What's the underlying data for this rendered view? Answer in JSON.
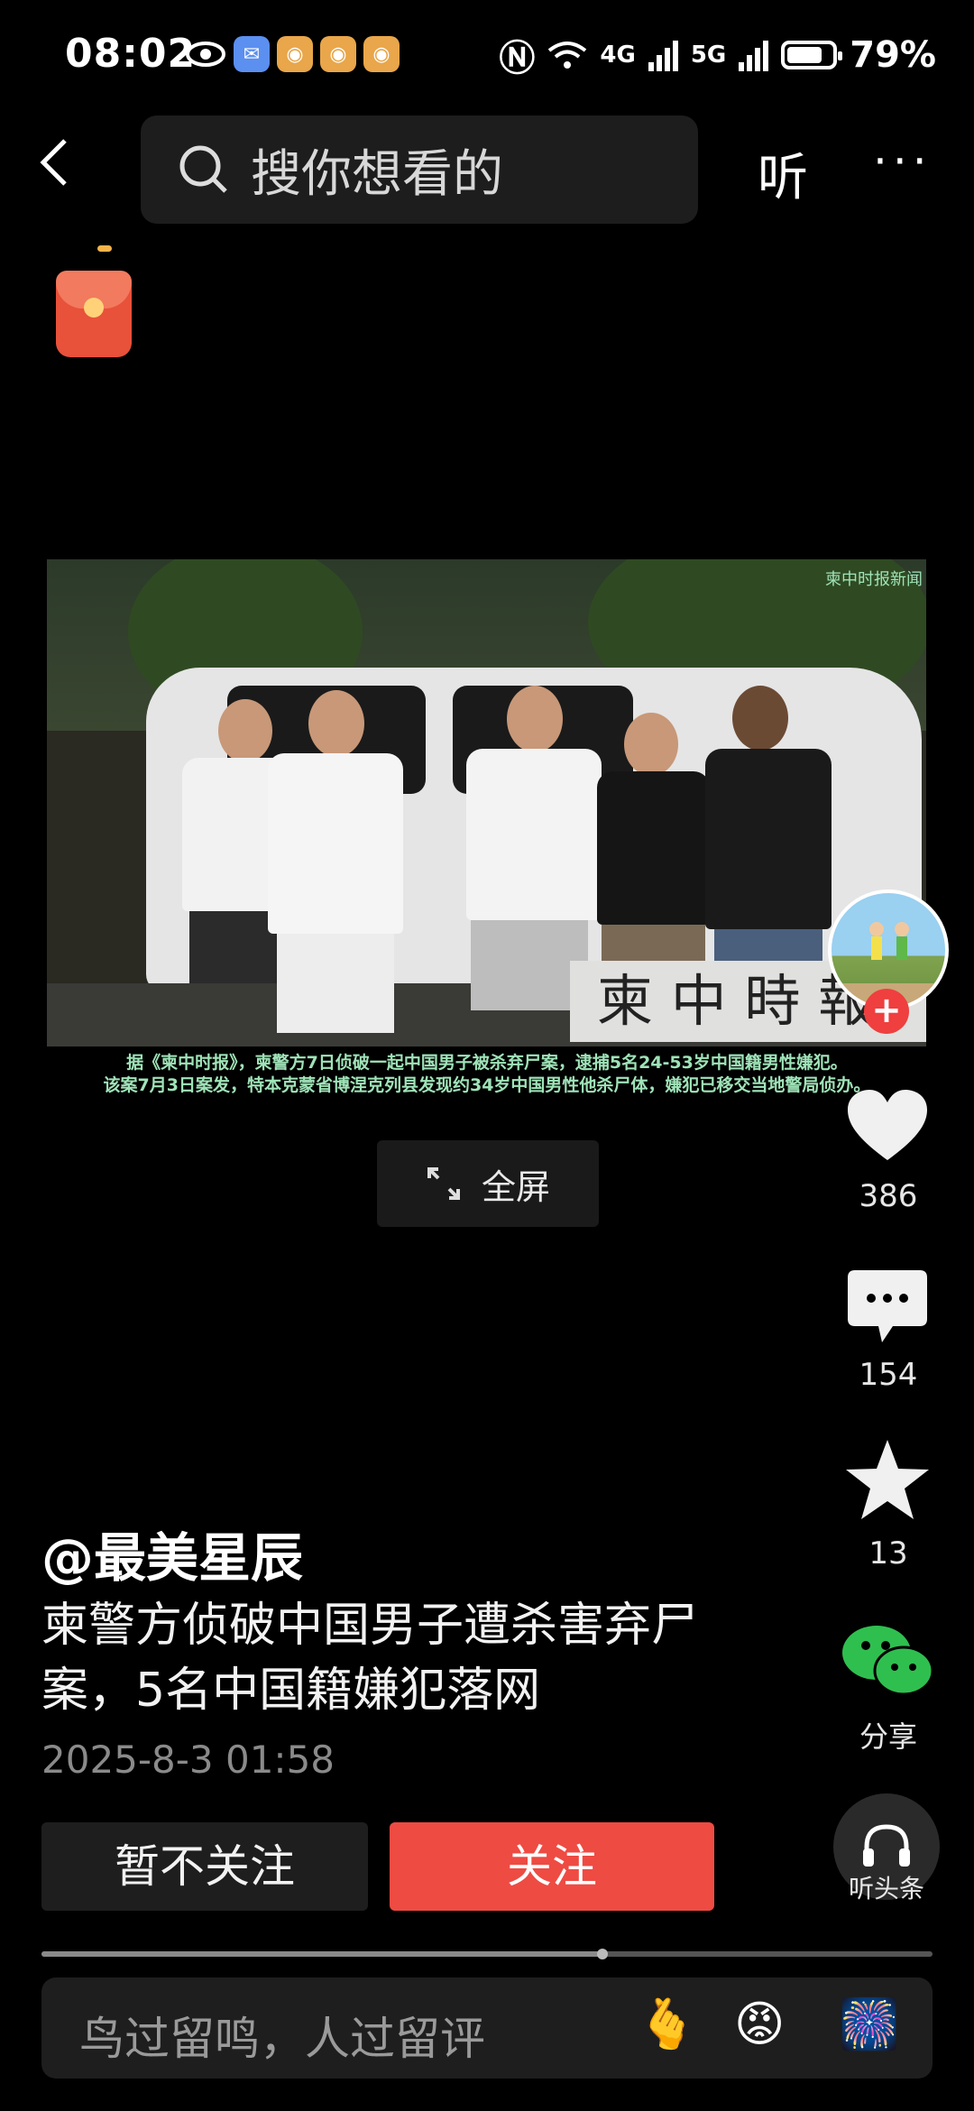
{
  "status_bar": {
    "time": "08:02",
    "network_4g": "4G",
    "network_5g": "5G",
    "battery": "79%",
    "battery_level": 0.79
  },
  "header": {
    "search_placeholder": "搜你想看的",
    "listen": "听"
  },
  "video": {
    "overlay_tag": "柬中时报新闻",
    "sign_text": "柬 中  時 報",
    "caption_line1": "据《柬中时报》，柬警方7日侦破一起中国男子被杀弃尸案，逮捕5名24-53岁中国籍男性嫌犯。",
    "caption_line2": "该案7月3日案发，特本克蒙省博涅克列县发现约34岁中国男性他杀尸体，嫌犯已移交当地警局侦办。",
    "fullscreen_label": "全屏"
  },
  "rail": {
    "likes": "386",
    "comments": "154",
    "favorites": "13",
    "share_label": "分享",
    "listen_label": "听头条"
  },
  "post": {
    "author": "@最美星辰",
    "title": "柬警方侦破中国男子遭杀害弃尸案，5名中国籍嫌犯落网",
    "date": "2025-8-3 01:58",
    "unfollow_label": "暂不关注",
    "follow_label": "关注"
  },
  "progress": 0.63,
  "comment": {
    "placeholder": "鸟过留鸣，人过留评"
  },
  "colors": {
    "accent": "#ee4b43",
    "caption": "#9fe3b8",
    "wechat": "#2fbf4f"
  }
}
